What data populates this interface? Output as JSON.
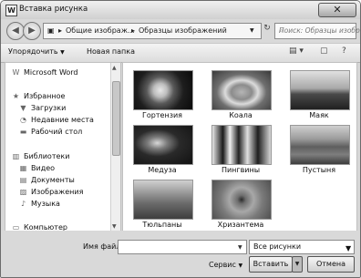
{
  "window": {
    "title": "Вставка рисунка",
    "app_icon_letter": "W",
    "close_glyph": "✕"
  },
  "nav": {
    "path": [
      "Общие изображ...",
      "Образцы изображений"
    ],
    "search_placeholder": "Поиск: Образцы изобр..."
  },
  "toolbar": {
    "organize_label": "Упорядочить",
    "new_folder_label": "Новая папка"
  },
  "sidebar": {
    "items": [
      {
        "label": "Microsoft Word",
        "icon": "word-icon"
      },
      {
        "label": "Избранное",
        "icon": "star-icon"
      },
      {
        "label": "Загрузки",
        "icon": "downloads-folder-icon"
      },
      {
        "label": "Недавние места",
        "icon": "recent-places-icon"
      },
      {
        "label": "Рабочий стол",
        "icon": "desktop-icon"
      },
      {
        "label": "Библиотеки",
        "icon": "libraries-icon"
      },
      {
        "label": "Видео",
        "icon": "video-library-icon"
      },
      {
        "label": "Документы",
        "icon": "documents-library-icon"
      },
      {
        "label": "Изображения",
        "icon": "pictures-library-icon"
      },
      {
        "label": "Музыка",
        "icon": "music-library-icon"
      },
      {
        "label": "Компьютер",
        "icon": "computer-icon"
      }
    ]
  },
  "files": [
    {
      "label": "Гортензия"
    },
    {
      "label": "Коала"
    },
    {
      "label": "Маяк"
    },
    {
      "label": "Медуза"
    },
    {
      "label": "Пингвины"
    },
    {
      "label": "Пустыня"
    },
    {
      "label": "Тюльпаны"
    },
    {
      "label": "Хризантема"
    }
  ],
  "footer": {
    "filename_label": "Имя файла:",
    "filename_value": "",
    "filetype_value": "Все рисунки",
    "service_label": "Сервис",
    "insert_label": "Вставить",
    "cancel_label": "Отмена"
  }
}
